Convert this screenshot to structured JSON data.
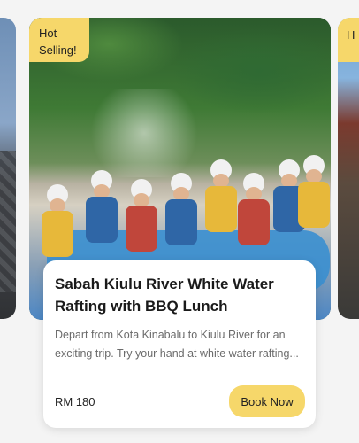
{
  "prev_card": {
    "image_alt": "mountain-city-photo"
  },
  "next_card": {
    "badge_partial": "H",
    "image_alt": "building-photo"
  },
  "card": {
    "badge": "Hot Selling!",
    "image_alt": "white-water-rafting-photo",
    "title": "Sabah Kiulu River White Water Rafting with BBQ Lunch",
    "description": "Depart from Kota Kinabalu to Kiulu River for an exciting trip. Try your hand at white water rafting...",
    "price": "RM 180",
    "cta_label": "Book Now"
  },
  "colors": {
    "accent": "#f6d76a",
    "card_bg": "#ffffff",
    "text": "#1a1a1a",
    "muted": "#6b6b6b"
  }
}
